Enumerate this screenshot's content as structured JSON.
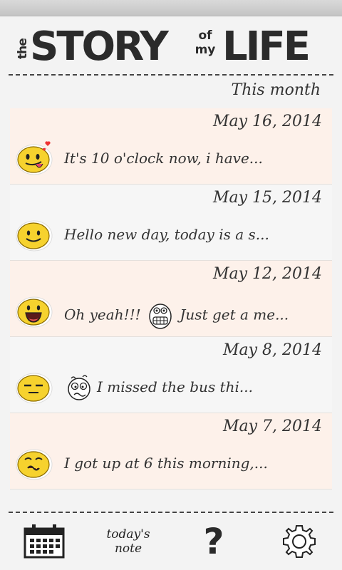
{
  "header": {
    "logo_the": "the",
    "logo_story": "STORY",
    "logo_of": "of",
    "logo_my": "my",
    "logo_life": "LIFE"
  },
  "section_title": "This month",
  "entries": [
    {
      "date": "May 16, 2014",
      "text": "It's 10 o'clock now, i have...",
      "face": "tongue-hearts-face-icon"
    },
    {
      "date": "May 15, 2014",
      "text": "Hello new day, today is a s...",
      "face": "smile-face-icon"
    },
    {
      "date": "May 12, 2014",
      "text_before": "Oh yeah!!!",
      "text_after": "Just get a me...",
      "face": "laugh-face-icon",
      "inline_icon": "grin-doodle-icon"
    },
    {
      "date": "May 8, 2014",
      "text": "I missed the bus thi...",
      "face": "neutral-face-icon",
      "inline_icon": "dizzy-doodle-icon"
    },
    {
      "date": "May 7, 2014",
      "text": "I got up at 6 this morning,...",
      "face": "sick-face-icon"
    }
  ],
  "footer": {
    "note_line1": "today's",
    "note_line2": "note",
    "help_label": "?"
  },
  "colors": {
    "entry_pink": "#fdf1ea",
    "entry_white": "#f6f6f6",
    "face_yellow": "#f6d22e",
    "ink": "#2b2b2b"
  }
}
